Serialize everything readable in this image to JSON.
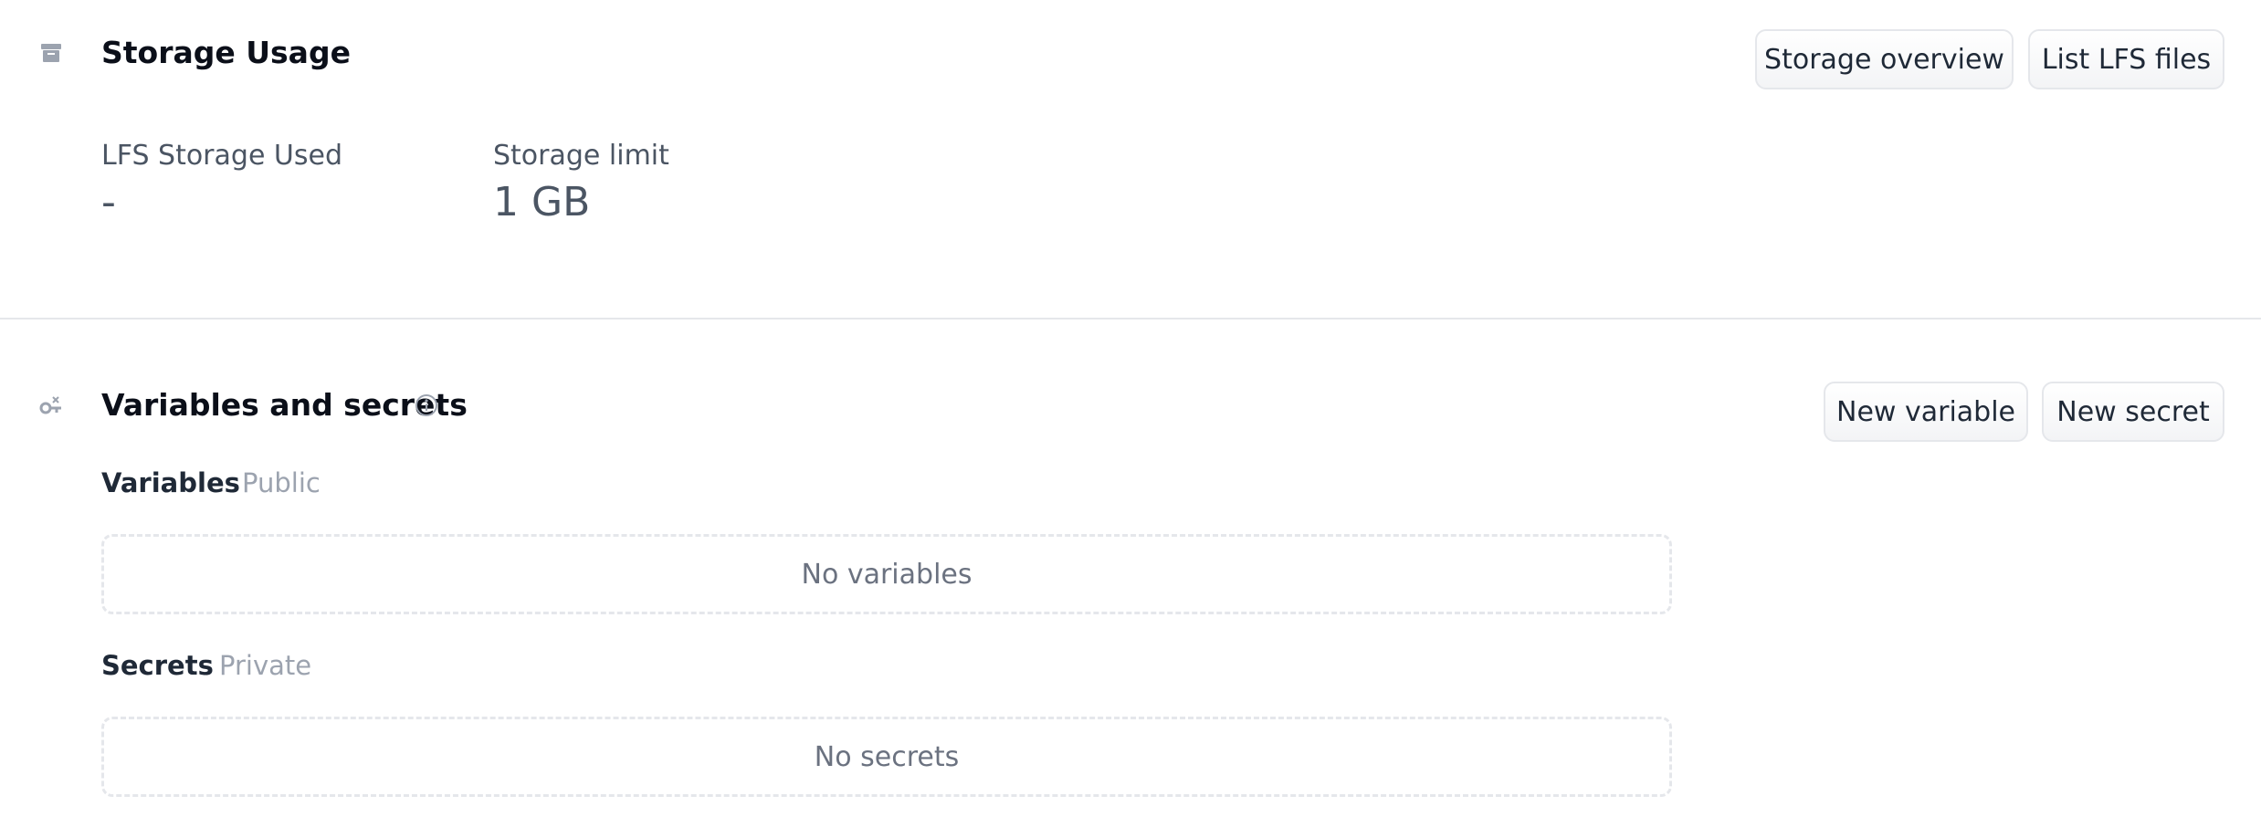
{
  "storage": {
    "icon": "archive-box-icon",
    "title": "Storage Usage",
    "overview_button": "Storage overview",
    "list_lfs_button": "List LFS files",
    "lfs_used_label": "LFS Storage Used",
    "lfs_used_value": "-",
    "limit_label": "Storage limit",
    "limit_value": "1 GB"
  },
  "variables_secrets": {
    "icon": "key-icon",
    "title": "Variables and secrets",
    "info_icon": "info-icon",
    "new_variable_button": "New variable",
    "new_secret_button": "New secret",
    "variables": {
      "heading": "Variables",
      "tag": "Public",
      "empty_text": "No variables"
    },
    "secrets": {
      "heading": "Secrets",
      "tag": "Private",
      "empty_text": "No secrets"
    }
  },
  "colors": {
    "border": "#e5e7eb",
    "muted_text": "#9ca3af",
    "body_text": "#4b5563",
    "title_text": "#0b0f19"
  }
}
